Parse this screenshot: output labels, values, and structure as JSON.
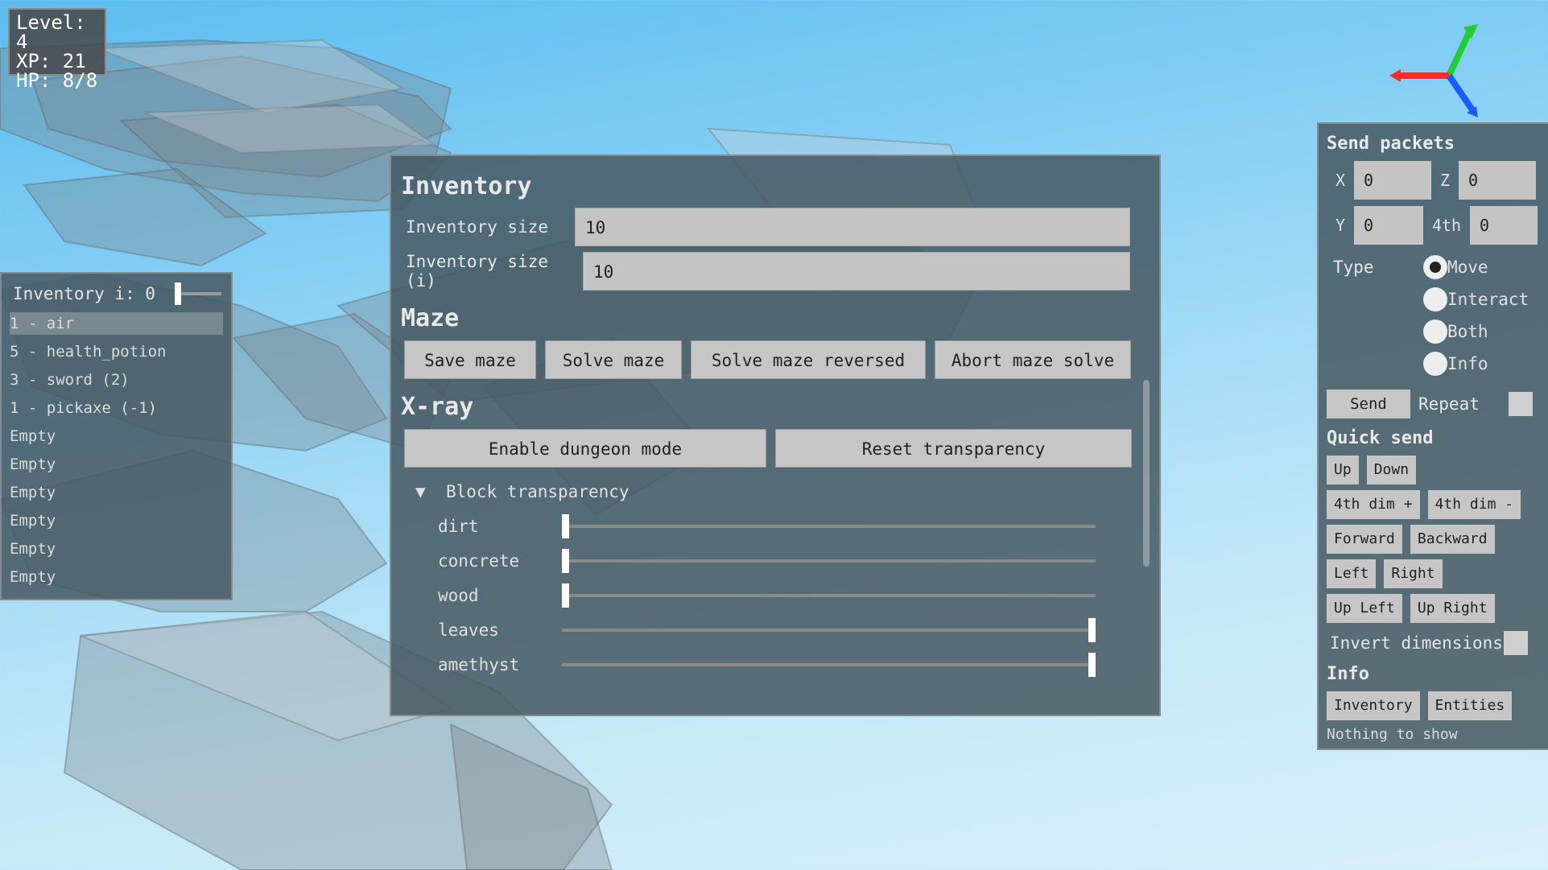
{
  "hud": {
    "level": "Level: 4",
    "xp": "XP: 21",
    "hp": "HP: 8/8"
  },
  "inventory_panel": {
    "title": "Inventory i: 0",
    "slider_value": 0,
    "items": [
      {
        "label": "1 - air",
        "selected": true
      },
      {
        "label": "5 - health_potion"
      },
      {
        "label": "3 - sword (2)"
      },
      {
        "label": "1 - pickaxe (-1)"
      },
      {
        "label": "Empty"
      },
      {
        "label": "Empty"
      },
      {
        "label": "Empty"
      },
      {
        "label": "Empty"
      },
      {
        "label": "Empty"
      },
      {
        "label": "Empty"
      }
    ]
  },
  "main": {
    "inventory_title": "Inventory",
    "inventory_size_label": "Inventory size",
    "inventory_size_value": "10",
    "inventory_size_i_label": "Inventory size (i)",
    "inventory_size_i_value": "10",
    "maze_title": "Maze",
    "maze_buttons": [
      "Save maze",
      "Solve maze",
      "Solve maze reversed",
      "Abort maze solve"
    ],
    "xray_title": "X-ray",
    "xray_buttons": [
      "Enable dungeon mode",
      "Reset transparency"
    ],
    "block_transparency_label": "Block transparency",
    "blocks": [
      {
        "name": "dirt",
        "value": 0
      },
      {
        "name": "concrete",
        "value": 0
      },
      {
        "name": "wood",
        "value": 0
      },
      {
        "name": "leaves",
        "value": 1
      },
      {
        "name": "amethyst",
        "value": 1
      }
    ]
  },
  "send_packets": {
    "title": "Send packets",
    "x_label": "X",
    "x_value": "0",
    "z_label": "Z",
    "z_value": "0",
    "y_label": "Y",
    "y_value": "0",
    "w_label": "4th",
    "w_value": "0",
    "type_label": "Type",
    "types": [
      "Move",
      "Interact",
      "Both",
      "Info"
    ],
    "selected_type": "Move",
    "send_label": "Send",
    "repeat_label": "Repeat",
    "quick_send_title": "Quick send",
    "quick_buttons": [
      [
        "Up",
        "Down"
      ],
      [
        "4th dim +",
        "4th dim -"
      ],
      [
        "Forward",
        "Backward"
      ],
      [
        "Left",
        "Right"
      ],
      [
        "Up Left",
        "Up Right"
      ]
    ],
    "invert_label": "Invert dimensions",
    "info_title": "Info",
    "info_buttons": [
      "Inventory",
      "Entities"
    ],
    "info_note": "Nothing to show"
  },
  "colors": {
    "axis_x": "#ff2a2a",
    "axis_y": "#22cc33",
    "axis_z": "#1a5cff"
  },
  "icons": {
    "axis_gizmo": "axes-gizmo-icon",
    "tree_toggle": "triangle-down-icon"
  }
}
